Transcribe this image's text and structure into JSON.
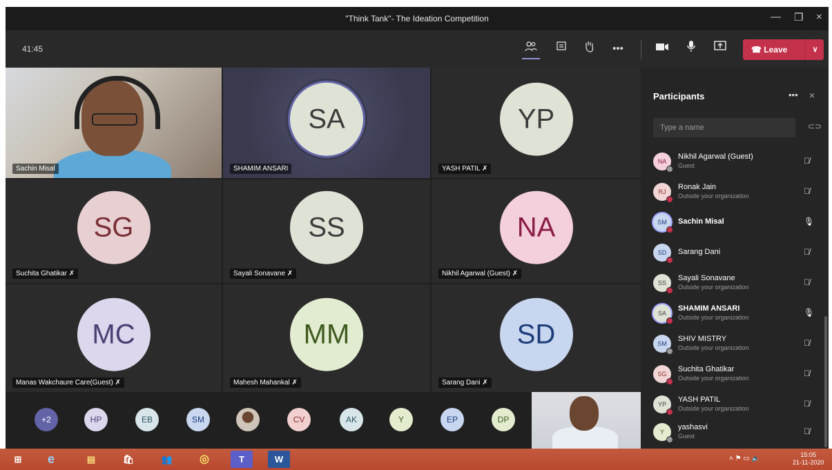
{
  "window": {
    "title": "\"Think Tank\"- The Ideation Competition",
    "min": "—",
    "restore": "❐",
    "close": "×"
  },
  "toolbar": {
    "timer": "41:45",
    "participants_icon": "people-icon",
    "chat_icon": "chat-icon",
    "hand_icon": "raise-hand-icon",
    "more": "•••",
    "camera_icon": "camera-icon",
    "mic_icon": "mic-icon",
    "share_icon": "share-screen-icon",
    "leave_label": "Leave",
    "leave_chevron": "∨",
    "accent": "#c4314b"
  },
  "tiles": [
    {
      "name": "Sachin Misal",
      "video": true
    },
    {
      "name": "SHAMIM ANSARI",
      "initials": "SA",
      "bg": "#dfe3d6",
      "fg": "#3c3c3c"
    },
    {
      "name": "YASH PATIL",
      "initials": "YP",
      "bg": "#dfe3d6",
      "fg": "#3c3c3c",
      "muted": true
    },
    {
      "name": "Suchita Ghatikar",
      "initials": "SG",
      "bg": "#e8cfd2",
      "fg": "#7a2e36",
      "muted": true
    },
    {
      "name": "Sayali Sonavane",
      "initials": "SS",
      "bg": "#dfe3d6",
      "fg": "#3c3c3c",
      "muted": true
    },
    {
      "name": "Nikhil Agarwal (Guest)",
      "initials": "NA",
      "bg": "#f4cfdc",
      "fg": "#8b1e44",
      "muted": true
    },
    {
      "name": "Manas Wakchaure Care(Guest)",
      "initials": "MC",
      "bg": "#dcd7ec",
      "fg": "#4a3f73",
      "muted": true
    },
    {
      "name": "Mahesh Mahankal",
      "initials": "MM",
      "bg": "#e2ecd0",
      "fg": "#3e5a1e",
      "muted": true
    },
    {
      "name": "Sarang Dani",
      "initials": "SD",
      "bg": "#c8d6ef",
      "fg": "#1d3d7a",
      "muted": true
    }
  ],
  "mute_glyph": "🎙̸",
  "strip": [
    {
      "initials": "+2",
      "bg": "#6264a7",
      "fg": "#ffffff"
    },
    {
      "initials": "HP",
      "bg": "#dcd7ec",
      "fg": "#4a3f73"
    },
    {
      "initials": "EB",
      "bg": "#d8e6ea",
      "fg": "#2c5560"
    },
    {
      "initials": "SM",
      "bg": "#c8d6ef",
      "fg": "#1d3d7a"
    },
    {
      "initials": "",
      "bg": "#9b7a66",
      "fg": "#ffffff",
      "photo": true
    },
    {
      "initials": "CV",
      "bg": "#f2d0d0",
      "fg": "#8b2c2c"
    },
    {
      "initials": "AK",
      "bg": "#d8e6ea",
      "fg": "#2c5560"
    },
    {
      "initials": "Y",
      "bg": "#e4ecd0",
      "fg": "#3e5a1e"
    },
    {
      "initials": "EP",
      "bg": "#c8d6ef",
      "fg": "#1d3d7a"
    },
    {
      "initials": "DP",
      "bg": "#e4ecd0",
      "fg": "#3e5a1e"
    }
  ],
  "panel": {
    "title": "Participants",
    "more": "•••",
    "close": "×",
    "search_placeholder": "Type a name",
    "share_icon": "link-icon"
  },
  "participants": [
    {
      "initials": "NA",
      "name": "Nikhil Agarwal (Guest)",
      "sub": "Guest",
      "bg": "#f4cfdc",
      "fg": "#8b1e44",
      "badge": "#999999",
      "mic": "muted"
    },
    {
      "initials": "RJ",
      "name": "Ronak Jain",
      "sub": "Outside your organization",
      "bg": "#f2d6d6",
      "fg": "#8b2c2c",
      "badge": "#c4314b",
      "mic": "muted"
    },
    {
      "initials": "SM",
      "name": "Sachin Misal",
      "sub": "",
      "bg": "#c8d6ef",
      "fg": "#1d3d7a",
      "badge": "#c4314b",
      "mic": "on",
      "bold": true
    },
    {
      "initials": "SD",
      "name": "Sarang Dani",
      "sub": "",
      "bg": "#c8d6ef",
      "fg": "#1d3d7a",
      "badge": "#c4314b",
      "mic": "muted"
    },
    {
      "initials": "SS",
      "name": "Sayali Sonavane",
      "sub": "Outside your organization",
      "bg": "#dfe3d6",
      "fg": "#3c3c3c",
      "badge": "#c4314b",
      "mic": "muted"
    },
    {
      "initials": "SA",
      "name": "SHAMIM ANSARI",
      "sub": "Outside your organization",
      "bg": "#dfe3d6",
      "fg": "#3c3c3c",
      "badge": "#c4314b",
      "mic": "on",
      "bold": true
    },
    {
      "initials": "SM",
      "name": "SHIV MISTRY",
      "sub": "Outside your organization",
      "bg": "#c8d6ef",
      "fg": "#1d3d7a",
      "badge": "#999999",
      "mic": "muted"
    },
    {
      "initials": "SG",
      "name": "Suchita Ghatikar",
      "sub": "Outside your organization",
      "bg": "#f2d6d6",
      "fg": "#8b2c2c",
      "badge": "#c4314b",
      "mic": "muted"
    },
    {
      "initials": "YP",
      "name": "YASH PATIL",
      "sub": "Outside your organization",
      "bg": "#dfe3d6",
      "fg": "#3c3c3c",
      "badge": "#c4314b",
      "mic": "muted"
    },
    {
      "initials": "Y",
      "name": "yashasvi",
      "sub": "Guest",
      "bg": "#e4ecd0",
      "fg": "#3e5a1e",
      "badge": "#999999",
      "mic": "muted"
    }
  ],
  "taskbar": {
    "apps": [
      "windows-start-icon",
      "edge-icon",
      "file-explorer-icon",
      "store-icon",
      "people-app-icon",
      "chrome-icon",
      "teams-icon",
      "word-icon"
    ],
    "app_glyphs": [
      "⊞",
      "e",
      "▤",
      "🛍",
      "👥",
      "◎",
      "T",
      "W"
    ],
    "tray": "˄  ⚑  ▭  🔈",
    "time": "15:05",
    "date": "21-11-2020"
  }
}
